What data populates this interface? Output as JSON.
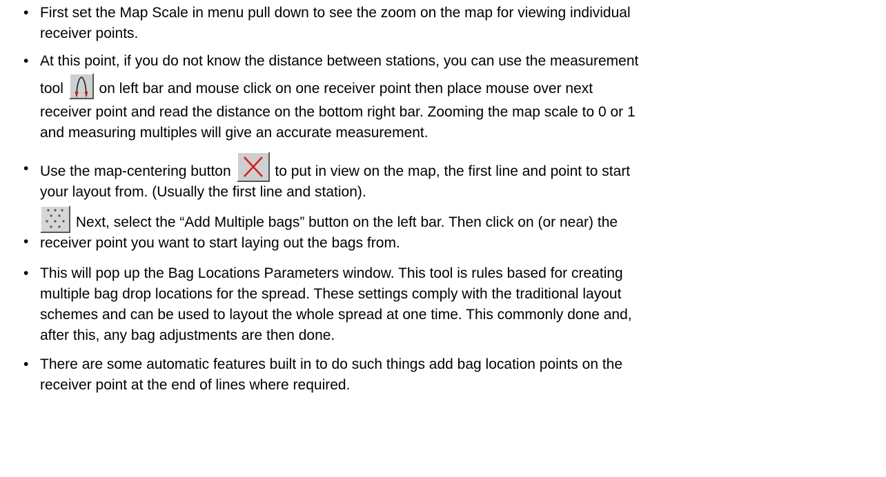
{
  "bullet_symbol": "•",
  "items": [
    {
      "lines": [
        "First set the Map Scale in menu pull down to see the zoom on the map for viewing individual",
        "receiver points."
      ]
    },
    {
      "line1": "At this point, if you do not know the distance between stations, you can use the measurement",
      "line2_pre": "tool",
      "line2_post": "on left bar and mouse click on one receiver point then place mouse over next",
      "line3": "receiver point and read the distance on the bottom right bar. Zooming the map scale to 0 or 1",
      "line4": "and measuring multiples will give an accurate measurement.",
      "icon": "measurement-tool-icon"
    },
    {
      "line1_pre": "Use the map-centering button",
      "line1_post": "to put in view on the map, the first line and point to start",
      "line2": "your layout from. (Usually the first line and station).",
      "icon": "map-centering-icon"
    },
    {
      "line1_post": "Next, select the “Add Multiple bags” button on the left bar. Then click on (or near) the",
      "line2": "receiver point you want to start laying out the bags from.",
      "icon": "add-multiple-bags-icon"
    },
    {
      "lines": [
        "This will pop up the Bag Locations Parameters window. This tool is rules based for creating",
        "multiple bag drop locations for the spread. These settings comply with the traditional layout",
        "schemes and can be used to layout the whole spread at one time. This commonly done and,",
        "after this, any bag adjustments are then done."
      ]
    },
    {
      "lines": [
        "There are some automatic features built in to do such things add bag location points on the",
        "receiver point at the end of lines where required."
      ]
    }
  ],
  "colors": {
    "text": "#000000",
    "icon_face": "#cfcfcf",
    "icon_red": "#d42020"
  }
}
